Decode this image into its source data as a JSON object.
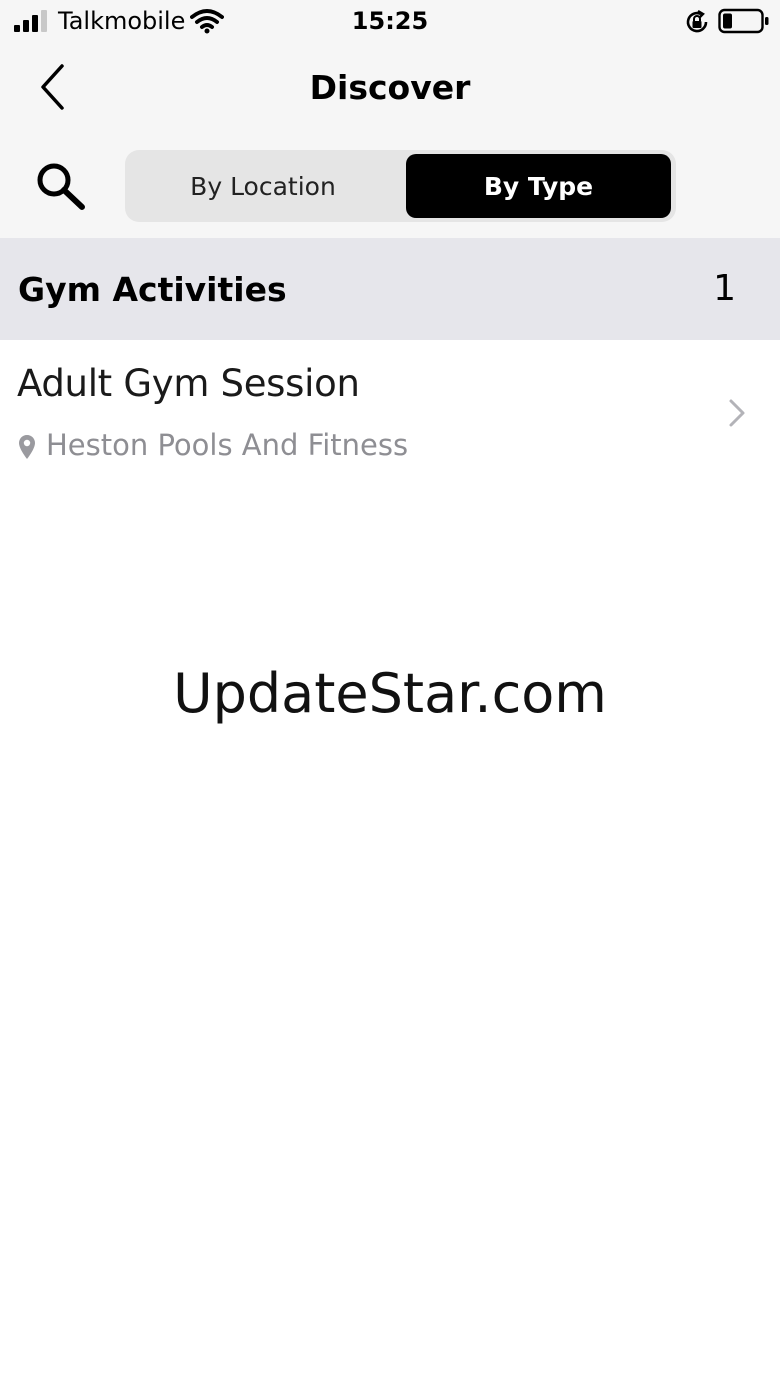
{
  "status_bar": {
    "carrier": "Talkmobile",
    "time": "15:25",
    "icons": [
      "signal-icon",
      "wifi-icon",
      "lock-rotation-icon",
      "battery-icon"
    ],
    "battery_level": 0.25
  },
  "nav": {
    "title": "Discover",
    "back_icon": "chevron-left-icon",
    "search_icon": "search-icon"
  },
  "segmented_control": {
    "options": [
      {
        "label": "By Location",
        "selected": false
      },
      {
        "label": "By Type",
        "selected": true
      }
    ],
    "selected_bg": "#000000",
    "selected_fg": "#ffffff"
  },
  "section": {
    "title": "Gym Activities",
    "count": "1"
  },
  "list": {
    "items": [
      {
        "title": "Adult Gym Session",
        "location": "Heston Pools And Fitness",
        "location_icon": "location-pin-icon",
        "accessory_icon": "chevron-right-icon"
      }
    ]
  },
  "watermark": "UpdateStar.com",
  "colors": {
    "header_bg": "#f6f6f6",
    "section_bg": "#e6e6eb",
    "subtitle": "#8e8e93"
  }
}
